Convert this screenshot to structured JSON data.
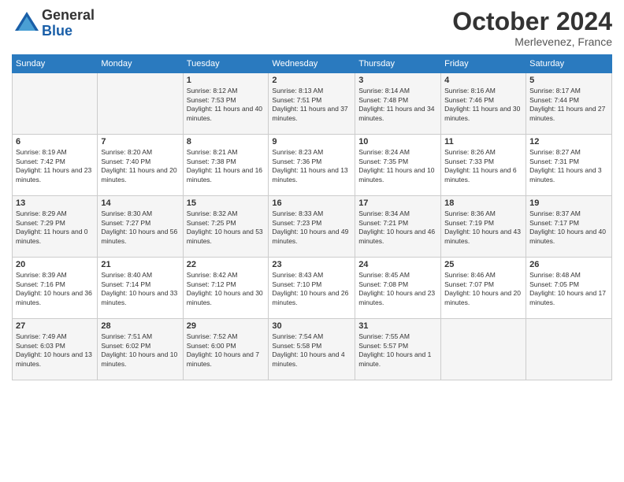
{
  "logo": {
    "general": "General",
    "blue": "Blue"
  },
  "title": "October 2024",
  "location": "Merlevenez, France",
  "header_days": [
    "Sunday",
    "Monday",
    "Tuesday",
    "Wednesday",
    "Thursday",
    "Friday",
    "Saturday"
  ],
  "weeks": [
    [
      {
        "day": "",
        "info": ""
      },
      {
        "day": "",
        "info": ""
      },
      {
        "day": "1",
        "info": "Sunrise: 8:12 AM\nSunset: 7:53 PM\nDaylight: 11 hours and 40 minutes."
      },
      {
        "day": "2",
        "info": "Sunrise: 8:13 AM\nSunset: 7:51 PM\nDaylight: 11 hours and 37 minutes."
      },
      {
        "day": "3",
        "info": "Sunrise: 8:14 AM\nSunset: 7:48 PM\nDaylight: 11 hours and 34 minutes."
      },
      {
        "day": "4",
        "info": "Sunrise: 8:16 AM\nSunset: 7:46 PM\nDaylight: 11 hours and 30 minutes."
      },
      {
        "day": "5",
        "info": "Sunrise: 8:17 AM\nSunset: 7:44 PM\nDaylight: 11 hours and 27 minutes."
      }
    ],
    [
      {
        "day": "6",
        "info": "Sunrise: 8:19 AM\nSunset: 7:42 PM\nDaylight: 11 hours and 23 minutes."
      },
      {
        "day": "7",
        "info": "Sunrise: 8:20 AM\nSunset: 7:40 PM\nDaylight: 11 hours and 20 minutes."
      },
      {
        "day": "8",
        "info": "Sunrise: 8:21 AM\nSunset: 7:38 PM\nDaylight: 11 hours and 16 minutes."
      },
      {
        "day": "9",
        "info": "Sunrise: 8:23 AM\nSunset: 7:36 PM\nDaylight: 11 hours and 13 minutes."
      },
      {
        "day": "10",
        "info": "Sunrise: 8:24 AM\nSunset: 7:35 PM\nDaylight: 11 hours and 10 minutes."
      },
      {
        "day": "11",
        "info": "Sunrise: 8:26 AM\nSunset: 7:33 PM\nDaylight: 11 hours and 6 minutes."
      },
      {
        "day": "12",
        "info": "Sunrise: 8:27 AM\nSunset: 7:31 PM\nDaylight: 11 hours and 3 minutes."
      }
    ],
    [
      {
        "day": "13",
        "info": "Sunrise: 8:29 AM\nSunset: 7:29 PM\nDaylight: 11 hours and 0 minutes."
      },
      {
        "day": "14",
        "info": "Sunrise: 8:30 AM\nSunset: 7:27 PM\nDaylight: 10 hours and 56 minutes."
      },
      {
        "day": "15",
        "info": "Sunrise: 8:32 AM\nSunset: 7:25 PM\nDaylight: 10 hours and 53 minutes."
      },
      {
        "day": "16",
        "info": "Sunrise: 8:33 AM\nSunset: 7:23 PM\nDaylight: 10 hours and 49 minutes."
      },
      {
        "day": "17",
        "info": "Sunrise: 8:34 AM\nSunset: 7:21 PM\nDaylight: 10 hours and 46 minutes."
      },
      {
        "day": "18",
        "info": "Sunrise: 8:36 AM\nSunset: 7:19 PM\nDaylight: 10 hours and 43 minutes."
      },
      {
        "day": "19",
        "info": "Sunrise: 8:37 AM\nSunset: 7:17 PM\nDaylight: 10 hours and 40 minutes."
      }
    ],
    [
      {
        "day": "20",
        "info": "Sunrise: 8:39 AM\nSunset: 7:16 PM\nDaylight: 10 hours and 36 minutes."
      },
      {
        "day": "21",
        "info": "Sunrise: 8:40 AM\nSunset: 7:14 PM\nDaylight: 10 hours and 33 minutes."
      },
      {
        "day": "22",
        "info": "Sunrise: 8:42 AM\nSunset: 7:12 PM\nDaylight: 10 hours and 30 minutes."
      },
      {
        "day": "23",
        "info": "Sunrise: 8:43 AM\nSunset: 7:10 PM\nDaylight: 10 hours and 26 minutes."
      },
      {
        "day": "24",
        "info": "Sunrise: 8:45 AM\nSunset: 7:08 PM\nDaylight: 10 hours and 23 minutes."
      },
      {
        "day": "25",
        "info": "Sunrise: 8:46 AM\nSunset: 7:07 PM\nDaylight: 10 hours and 20 minutes."
      },
      {
        "day": "26",
        "info": "Sunrise: 8:48 AM\nSunset: 7:05 PM\nDaylight: 10 hours and 17 minutes."
      }
    ],
    [
      {
        "day": "27",
        "info": "Sunrise: 7:49 AM\nSunset: 6:03 PM\nDaylight: 10 hours and 13 minutes."
      },
      {
        "day": "28",
        "info": "Sunrise: 7:51 AM\nSunset: 6:02 PM\nDaylight: 10 hours and 10 minutes."
      },
      {
        "day": "29",
        "info": "Sunrise: 7:52 AM\nSunset: 6:00 PM\nDaylight: 10 hours and 7 minutes."
      },
      {
        "day": "30",
        "info": "Sunrise: 7:54 AM\nSunset: 5:58 PM\nDaylight: 10 hours and 4 minutes."
      },
      {
        "day": "31",
        "info": "Sunrise: 7:55 AM\nSunset: 5:57 PM\nDaylight: 10 hours and 1 minute."
      },
      {
        "day": "",
        "info": ""
      },
      {
        "day": "",
        "info": ""
      }
    ]
  ]
}
